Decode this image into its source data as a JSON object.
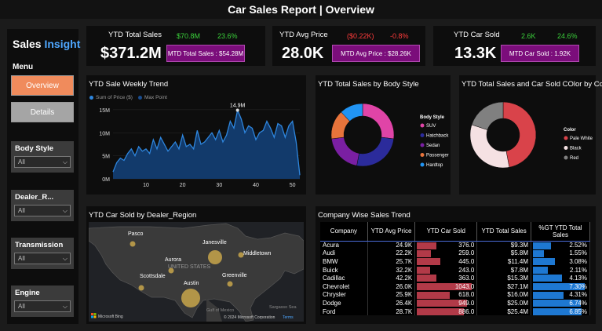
{
  "title": "Car Sales Report | Overview",
  "sidebar": {
    "brand_a": "Sales",
    "brand_b": "Insight",
    "menu_label": "Menu",
    "nav": [
      {
        "label": "Overview"
      },
      {
        "label": "Details"
      }
    ],
    "slicers": [
      {
        "label": "Body Style",
        "value": "All"
      },
      {
        "label": "Dealer_R...",
        "value": "All"
      },
      {
        "label": "Transmission",
        "value": "All"
      },
      {
        "label": "Engine",
        "value": "All"
      }
    ]
  },
  "kpis": [
    {
      "label": "YTD Total Sales",
      "value": "$371.2M",
      "delta_a": "$70.8M",
      "delta_b": "23.6%",
      "mtd": "MTD Total Sales : $54.28M",
      "color_a": "#3bd13b",
      "color_b": "#3bd13b"
    },
    {
      "label": "YTD Avg Price",
      "value": "28.0K",
      "delta_a": "($0.22K)",
      "delta_b": "-0.8%",
      "mtd": "MTD Avg Price : $28.26K",
      "color_a": "#ff3b3b",
      "color_b": "#ff3b3b"
    },
    {
      "label": "YTD Car Sold",
      "value": "13.3K",
      "delta_a": "2.6K",
      "delta_b": "24.6%",
      "mtd": "MTD Car Sold : 1.92K",
      "color_a": "#3bd13b",
      "color_b": "#3bd13b"
    }
  ],
  "weekly": {
    "title": "YTD Sale Weekly Trend",
    "legend": [
      "Sum of Price ($)",
      "Max Point"
    ],
    "peak_label": "14.9M"
  },
  "body_style": {
    "title": "YTD Total Sales by Body Style",
    "legend_title": "Body Style"
  },
  "color_chart": {
    "title": "YTD Total Sales and Car Sold COlor by Color",
    "legend_title": "Color"
  },
  "map": {
    "title": "YTD Car Sold by Dealer_Region",
    "cities": [
      "Pasco",
      "Janesville",
      "Aurora",
      "Middletown",
      "Scottsdale",
      "Greenville",
      "Austin"
    ],
    "country_label": "UNITED STATES",
    "gulf_label": "Gulf of\nMexico",
    "sea_label": "Sargasso Sea",
    "credit": "© 2024 Microsoft Corporation",
    "terms": "Terms",
    "provider": "Microsoft Bing"
  },
  "table": {
    "title": "Company Wise Sales Trend",
    "headers": [
      "Company",
      "YTD Avg Price",
      "YTD Car Sold",
      "YTD Total Sales",
      "%GT YTD Total Sales"
    ],
    "rows": [
      [
        "Acura",
        "24.9K",
        "376.0",
        "$9.3M",
        "2.52%"
      ],
      [
        "Audi",
        "22.2K",
        "259.0",
        "$5.8M",
        "1.55%"
      ],
      [
        "BMW",
        "25.7K",
        "445.0",
        "$11.4M",
        "3.08%"
      ],
      [
        "Buick",
        "32.2K",
        "243.0",
        "$7.8M",
        "2.11%"
      ],
      [
        "Cadillac",
        "42.2K",
        "363.0",
        "$15.3M",
        "4.13%"
      ],
      [
        "Chevrolet",
        "26.0K",
        "1043.0",
        "$27.1M",
        "7.30%"
      ],
      [
        "Chrysler",
        "25.9K",
        "618.0",
        "$16.0M",
        "4.31%"
      ],
      [
        "Dodge",
        "26.4K",
        "949.0",
        "$25.0M",
        "6.74%"
      ],
      [
        "Ford",
        "28.7K",
        "886.0",
        "$25.4M",
        "6.85%"
      ]
    ]
  },
  "chart_data": [
    {
      "type": "area",
      "title": "YTD Sale Weekly Trend",
      "xlabel": "",
      "ylabel": "",
      "xticks": [
        10,
        20,
        30,
        40,
        50
      ],
      "yticks": [
        "0M",
        "5M",
        "10M",
        "15M"
      ],
      "ylim": [
        0,
        16
      ],
      "x": [
        1,
        2,
        3,
        4,
        5,
        6,
        7,
        8,
        9,
        10,
        11,
        12,
        13,
        14,
        15,
        16,
        17,
        18,
        19,
        20,
        21,
        22,
        23,
        24,
        25,
        26,
        27,
        28,
        29,
        30,
        31,
        32,
        33,
        34,
        35,
        36,
        37,
        38,
        39,
        40,
        41,
        42,
        43,
        44,
        45,
        46,
        47,
        48,
        49,
        50,
        51,
        52
      ],
      "series": [
        {
          "name": "Sum of Price ($)",
          "values": [
            1.5,
            3.5,
            4.5,
            4.0,
            5.5,
            6.5,
            5.0,
            7.0,
            6.0,
            6.5,
            5.5,
            8.5,
            6.5,
            9.0,
            7.5,
            6.0,
            7.0,
            8.0,
            6.5,
            9.5,
            7.0,
            7.5,
            6.5,
            10.5,
            7.5,
            8.0,
            9.0,
            10.0,
            8.5,
            10.5,
            8.0,
            9.5,
            12.5,
            11.0,
            14.9,
            13.0,
            10.0,
            11.5,
            11.0,
            8.5,
            10.0,
            10.5,
            12.5,
            11.0,
            9.0,
            12.0,
            11.5,
            9.0,
            11.5,
            12.5,
            8.0,
            0.8
          ]
        }
      ],
      "max_point": {
        "x": 35,
        "y": 14.9
      }
    },
    {
      "type": "pie",
      "title": "YTD Total Sales by Body Style",
      "categories": [
        "SUV",
        "Hatchback",
        "Sedan",
        "Passenger",
        "Hardtop"
      ],
      "values": [
        27,
        26,
        20,
        15,
        12
      ],
      "colors": [
        "#e044a7",
        "#2b2b9b",
        "#7a1fa2",
        "#e8743b",
        "#2194f3"
      ]
    },
    {
      "type": "pie",
      "title": "YTD Total Sales and Car Sold COlor by Color",
      "categories": [
        "Pale White",
        "Black",
        "Red"
      ],
      "values": [
        47,
        33,
        20
      ],
      "colors": [
        "#d9434a",
        "#f5e1e3",
        "#808080"
      ]
    },
    {
      "type": "table",
      "title": "Company Wise Sales Trend",
      "car_sold_max": 1043,
      "pct_max": 7.3,
      "car_sold": [
        376,
        259,
        445,
        243,
        363,
        1043,
        618,
        949,
        886
      ],
      "pct": [
        2.52,
        1.55,
        3.08,
        2.11,
        4.13,
        7.3,
        4.31,
        6.74,
        6.85
      ]
    }
  ]
}
